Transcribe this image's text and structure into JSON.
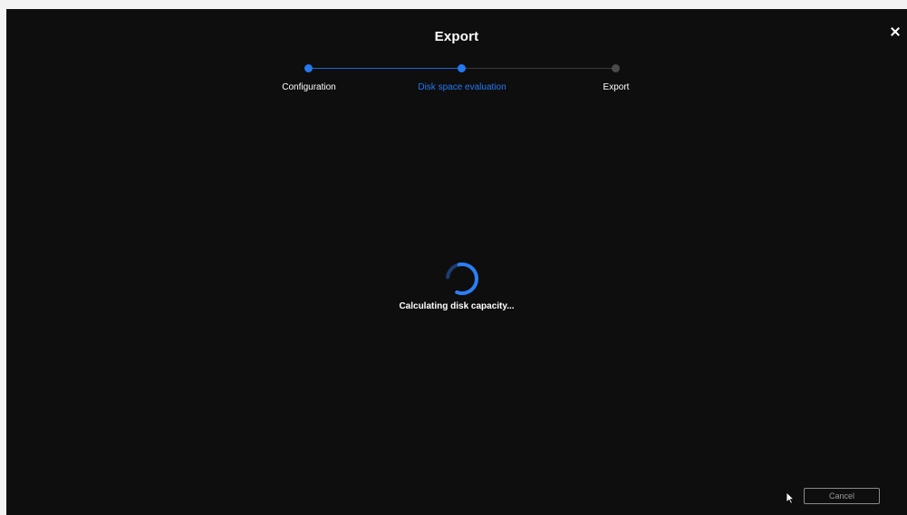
{
  "dialog": {
    "title": "Export",
    "close_icon": "close-icon"
  },
  "stepper": {
    "steps": [
      {
        "label": "Configuration",
        "state": "completed"
      },
      {
        "label": "Disk space evaluation",
        "state": "current"
      },
      {
        "label": "Export",
        "state": "pending"
      }
    ],
    "colors": {
      "active": "#2479f0",
      "inactive": "#4a4a4c"
    }
  },
  "main": {
    "spinner_icon": "loading-spinner-icon",
    "status_text": "Calculating disk capacity..."
  },
  "footer": {
    "cancel_label": "Cancel"
  }
}
